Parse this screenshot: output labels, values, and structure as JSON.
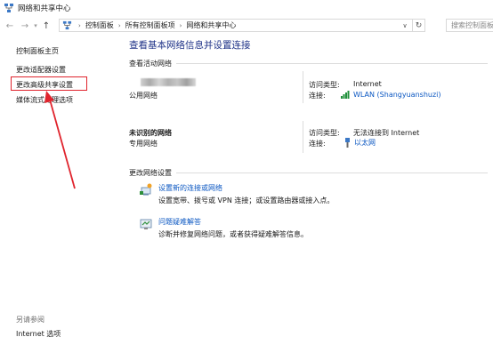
{
  "window": {
    "title": "网络和共享中心"
  },
  "address": {
    "breadcrumbs": [
      "控制面板",
      "所有控制面板项",
      "网络和共享中心"
    ],
    "search_placeholder": "搜索控制面板"
  },
  "sidebar": {
    "links": [
      "控制面板主页",
      "更改适配器设置",
      "更改高级共享设置",
      "媒体流式处理选项"
    ],
    "highlighted_index": 2,
    "see_also_title": "另请参阅",
    "see_also_links": [
      "Internet 选项"
    ]
  },
  "main": {
    "title": "查看基本网络信息并设置连接",
    "active_networks_label": "查看活动网络",
    "networks": [
      {
        "name": "",
        "type": "公用网络",
        "access_type_label": "访问类型:",
        "access_type": "Internet",
        "connection_label": "连接:",
        "connection": "WLAN (Shangyuanshuzi)"
      },
      {
        "name": "未识别的网络",
        "type": "专用网络",
        "access_type_label": "访问类型:",
        "access_type": "无法连接到 Internet",
        "connection_label": "连接:",
        "connection": "以太网"
      }
    ],
    "change_settings_label": "更改网络设置",
    "tasks": [
      {
        "link": "设置新的连接或网络",
        "desc": "设置宽带、拨号或 VPN 连接；或设置路由器或接入点。"
      },
      {
        "link": "问题疑难解答",
        "desc": "诊断并修复网络问题，或者获得疑难解答信息。"
      }
    ]
  },
  "colors": {
    "link": "#0b57c2",
    "title": "#1e3287",
    "highlight": "#e0242d"
  }
}
